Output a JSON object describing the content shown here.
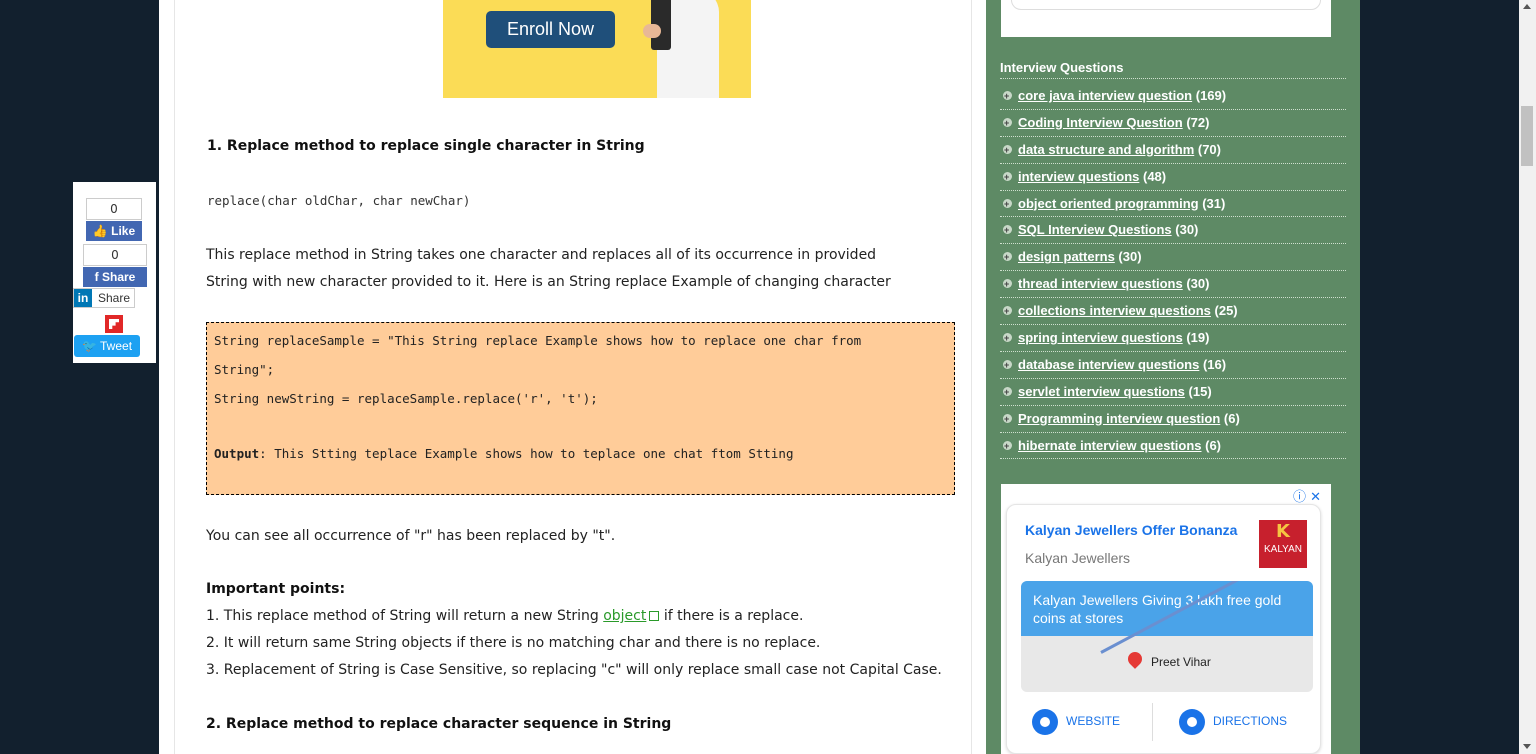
{
  "ad_banner": {
    "button_label": "Enroll Now"
  },
  "article": {
    "heading1": "1. Replace method to replace single character in String",
    "signature": "replace(char oldChar, char newChar)",
    "para1_line1": "This replace method in String takes one character and replaces all of its occurrence in provided",
    "para1_line2": "String with new character provided to it. Here is an String replace Example of changing character",
    "code_lines": [
      "String replaceSample = \"This String replace Example shows how to replace one char from",
      "String\";",
      "String newString = replaceSample.replace('r', 't');"
    ],
    "output_label": "Output",
    "output_text": ": This Stting teplace Example shows how to teplace one chat ftom Stting",
    "para2": "You can see all occurrence of \"r\" has been replaced by \"t\".",
    "important_heading": "Important points:",
    "point1_before": "1. This replace method of String will return a new String ",
    "point1_link": "object",
    "point1_after": " if there is a replace.",
    "point2": "2. It will return same String objects if there is no matching char and there is no replace.",
    "point3": "3. Replacement of String is Case Sensitive, so replacing \"c\" will only replace small case not Capital Case.",
    "heading2": "2. Replace method to replace character sequence in String"
  },
  "sidebar": {
    "title": "Interview Questions",
    "items": [
      {
        "label": "core java interview question",
        "count": "(169)"
      },
      {
        "label": "Coding Interview Question",
        "count": "(72)"
      },
      {
        "label": "data structure and algorithm",
        "count": "(70)"
      },
      {
        "label": "interview questions",
        "count": "(48)"
      },
      {
        "label": "object oriented programming",
        "count": "(31)"
      },
      {
        "label": "SQL Interview Questions",
        "count": "(30)"
      },
      {
        "label": "design patterns",
        "count": "(30)"
      },
      {
        "label": "thread interview questions",
        "count": "(30)"
      },
      {
        "label": "collections interview questions",
        "count": "(25)"
      },
      {
        "label": "spring interview questions",
        "count": "(19)"
      },
      {
        "label": "database interview questions",
        "count": "(16)"
      },
      {
        "label": "servlet interview questions",
        "count": "(15)"
      },
      {
        "label": "Programming interview question",
        "count": "(6)"
      },
      {
        "label": "hibernate interview questions",
        "count": "(6)"
      }
    ]
  },
  "sidebar_ad": {
    "close_glyphs": "ⓘ ✕",
    "title": "Kalyan Jewellers Offer Bonanza",
    "subtitle": "Kalyan Jewellers",
    "logo_text": "KALYAN",
    "map_headline": "Kalyan Jewellers Giving 3 lakh free gold coins at stores",
    "place": "Preet Vihar",
    "website_label": "WEBSITE",
    "directions_label": "DIRECTIONS"
  },
  "share": {
    "like_count": "0",
    "like_label": "Like",
    "share_count": "0",
    "share_label": "Share",
    "linkedin_label": "Share",
    "tweet_label": "Tweet"
  }
}
